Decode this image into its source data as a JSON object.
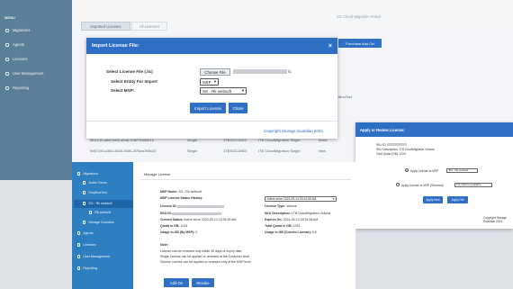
{
  "background_app": {
    "sidebar": {
      "brand": "MENU",
      "items": [
        {
          "label": "Migrations",
          "icon": "migration-icon"
        },
        {
          "label": "Agents",
          "icon": "agent-icon"
        },
        {
          "label": "Licenses",
          "icon": "license-icon"
        },
        {
          "label": "User Management",
          "icon": "users-icon"
        },
        {
          "label": "Reporting",
          "icon": "report-icon"
        }
      ]
    },
    "portal_title": "SG Cloud Migration Portal",
    "tabs": [
      "Imported Licenses",
      "All Licenses"
    ],
    "purchase_button": "Purchase Add-On",
    "table": {
      "headers": [
        "MSP",
        "Type"
      ],
      "rows": [
        {
          "id": "",
          "type": "",
          "msp": "DropBoxTest",
          "col4": ""
        },
        {
          "id": "",
          "type": "",
          "msp": "",
          "col4": ""
        },
        {
          "id": "",
          "type": "",
          "msp": "",
          "col4": ""
        },
        {
          "id": "",
          "type": "",
          "msp": "",
          "col4": ""
        },
        {
          "id": "",
          "type": "",
          "msp": "",
          "col4": ""
        },
        {
          "id": "f5b1210-a8ef-4d8f-a9a6-108274dd2b16",
          "type": "Single",
          "sku": "1TBSGC1M03",
          "product": "ITB CloudMigration Single",
          "extra": "None"
        },
        {
          "id": "9d57190-a384-4535-9000-2f75ad7b5b23",
          "type": "Single",
          "sku": "1TBSGC1M03",
          "product": "ITB CloudMigration Single",
          "extra": "New"
        }
      ]
    }
  },
  "import_modal": {
    "title": "Import License File:",
    "fields": [
      {
        "label": "Select License File (.lic)",
        "file_button": "Choose File",
        "file_ext": "lic"
      },
      {
        "label": "Select Entity For Import",
        "value": "MSP"
      },
      {
        "label": "Select MSP:",
        "value": "SG - Rk websoft"
      }
    ],
    "buttons": {
      "import": "Import License",
      "close": "Close"
    },
    "copyright": "Copyright Storage Guardian 2023"
  },
  "renew_panel": {
    "title": "Apply or Renew License:",
    "sku_label": "SKU ID:",
    "sku_description": "SKU Description: 1TB CloudMigration Volume",
    "total_quota": "Total Quota (GB): 1024",
    "option_apply_msp": "Apply License to MSP",
    "msp_value": "SG - Rk websoft",
    "option_apply_renewal": "Apply License to MSP (Renewal)",
    "renewal_value": "No options available",
    "buttons": {
      "apply_new": "Apply New",
      "apply_old": "Apply Old"
    },
    "copyright": "Copyright Storage Guardian 2023"
  },
  "manage_window": {
    "sidebar": {
      "items": [
        {
          "label": "Migrations",
          "icon": "migration-icon"
        },
        {
          "label": "Active Demo",
          "icon": "demo-icon"
        },
        {
          "label": "DropBoxTest",
          "icon": "dropbox-icon"
        },
        {
          "label": "SG - Rk websoft",
          "icon": "folder-icon"
        },
        {
          "label": "Rk websoft",
          "icon": "user-icon"
        },
        {
          "label": "Storage Guardian",
          "icon": "storage-icon"
        },
        {
          "label": "Agents",
          "icon": "agent-icon"
        },
        {
          "label": "Licenses",
          "icon": "license-icon"
        },
        {
          "label": "User Management",
          "icon": "users-icon"
        },
        {
          "label": "Reporting",
          "icon": "report-icon"
        }
      ]
    },
    "title": "Manage License",
    "msp_name": {
      "label": "MSP Name:",
      "value": "SG - Rk websoft"
    },
    "msp_status_history": {
      "label": "MSP License Status History:",
      "value": "Active since 2023-09-14 15:34:35 AM"
    },
    "license_id": {
      "label": "License ID:"
    },
    "license_type": {
      "label": "License Type:",
      "value": "Volume"
    },
    "sku_id": {
      "label": "SKU ID:"
    },
    "sku_description": {
      "label": "SKU Description:",
      "value": "1TB CloudMigration Volume"
    },
    "current_status": {
      "label": "Current Status:",
      "value": "Active since 2023-09-14 15:34:35 AM"
    },
    "expires_on": {
      "label": "Expires On:",
      "value": "2024-09-13 15:34:35 AM"
    },
    "quota": {
      "label": "Quota in GB:",
      "value": "1024"
    },
    "total_quota": {
      "label": "Total Quota in GB:",
      "value": "1024"
    },
    "usage_msp": {
      "label": "Usage in GB (By MSP):",
      "value": "0"
    },
    "usage_current": {
      "label": "Usage in GB (Current License):",
      "value": "0.6"
    },
    "note_title": "Note:",
    "notes": [
      "License can be renewed only within 30 days of expiry date.",
      "Single License can be applied or renewed at the Customer level.",
      "Volume License can be applied or renewed only at the MSP level."
    ],
    "buttons": {
      "addon": "Add-On",
      "revoke": "Revoke"
    }
  }
}
